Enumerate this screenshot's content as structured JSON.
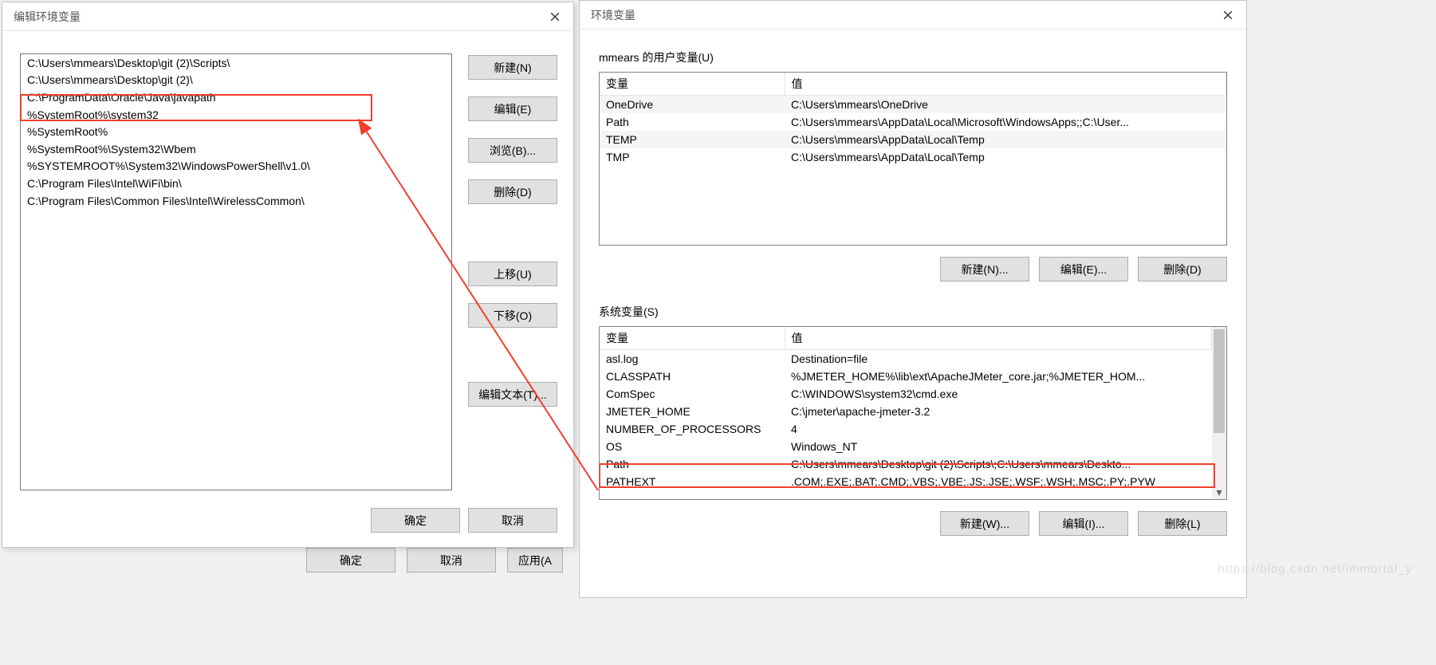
{
  "dlg_edit": {
    "title": "编辑环境变量",
    "items": [
      "C:\\Users\\mmears\\Desktop\\git (2)\\Scripts\\",
      "C:\\Users\\mmears\\Desktop\\git (2)\\",
      "C:\\ProgramData\\Oracle\\Java\\javapath",
      "%SystemRoot%\\system32",
      "%SystemRoot%",
      "%SystemRoot%\\System32\\Wbem",
      "%SYSTEMROOT%\\System32\\WindowsPowerShell\\v1.0\\",
      "C:\\Program Files\\Intel\\WiFi\\bin\\",
      "C:\\Program Files\\Common Files\\Intel\\WirelessCommon\\"
    ],
    "buttons": {
      "new": "新建(N)",
      "edit": "编辑(E)",
      "browse": "浏览(B)...",
      "delete": "删除(D)",
      "moveup": "上移(U)",
      "movedown": "下移(O)",
      "edittext": "编辑文本(T)..."
    },
    "ok": "确定",
    "cancel": "取消"
  },
  "dlg_env": {
    "title": "环境变量",
    "user_group": "mmears 的用户变量(U)",
    "sys_group": "系统变量(S)",
    "cols": {
      "var": "变量",
      "val": "值"
    },
    "user_vars": [
      {
        "name": "OneDrive",
        "value": "C:\\Users\\mmears\\OneDrive"
      },
      {
        "name": "Path",
        "value": "C:\\Users\\mmears\\AppData\\Local\\Microsoft\\WindowsApps;;C:\\User..."
      },
      {
        "name": "TEMP",
        "value": "C:\\Users\\mmears\\AppData\\Local\\Temp"
      },
      {
        "name": "TMP",
        "value": "C:\\Users\\mmears\\AppData\\Local\\Temp"
      }
    ],
    "sys_vars": [
      {
        "name": "asl.log",
        "value": "Destination=file"
      },
      {
        "name": "CLASSPATH",
        "value": "%JMETER_HOME%\\lib\\ext\\ApacheJMeter_core.jar;%JMETER_HOM..."
      },
      {
        "name": "ComSpec",
        "value": "C:\\WINDOWS\\system32\\cmd.exe"
      },
      {
        "name": "JMETER_HOME",
        "value": "C:\\jmeter\\apache-jmeter-3.2"
      },
      {
        "name": "NUMBER_OF_PROCESSORS",
        "value": "4"
      },
      {
        "name": "OS",
        "value": "Windows_NT"
      },
      {
        "name": "Path",
        "value": "C:\\Users\\mmears\\Desktop\\git (2)\\Scripts\\;C:\\Users\\mmears\\Deskto..."
      },
      {
        "name": "PATHEXT",
        "value": ".COM;.EXE;.BAT;.CMD;.VBS;.VBE;.JS;.JSE;.WSF;.WSH;.MSC;.PY;.PYW"
      }
    ],
    "buttons": {
      "user_new": "新建(N)...",
      "user_edit": "编辑(E)...",
      "user_delete": "删除(D)",
      "sys_new": "新建(W)...",
      "sys_edit": "编辑(I)...",
      "sys_delete": "删除(L)"
    }
  },
  "bg": {
    "ok": "确定",
    "cancel": "取消",
    "apply": "应用(A"
  },
  "watermark": "https://blog.csdn.net/immortal_y"
}
